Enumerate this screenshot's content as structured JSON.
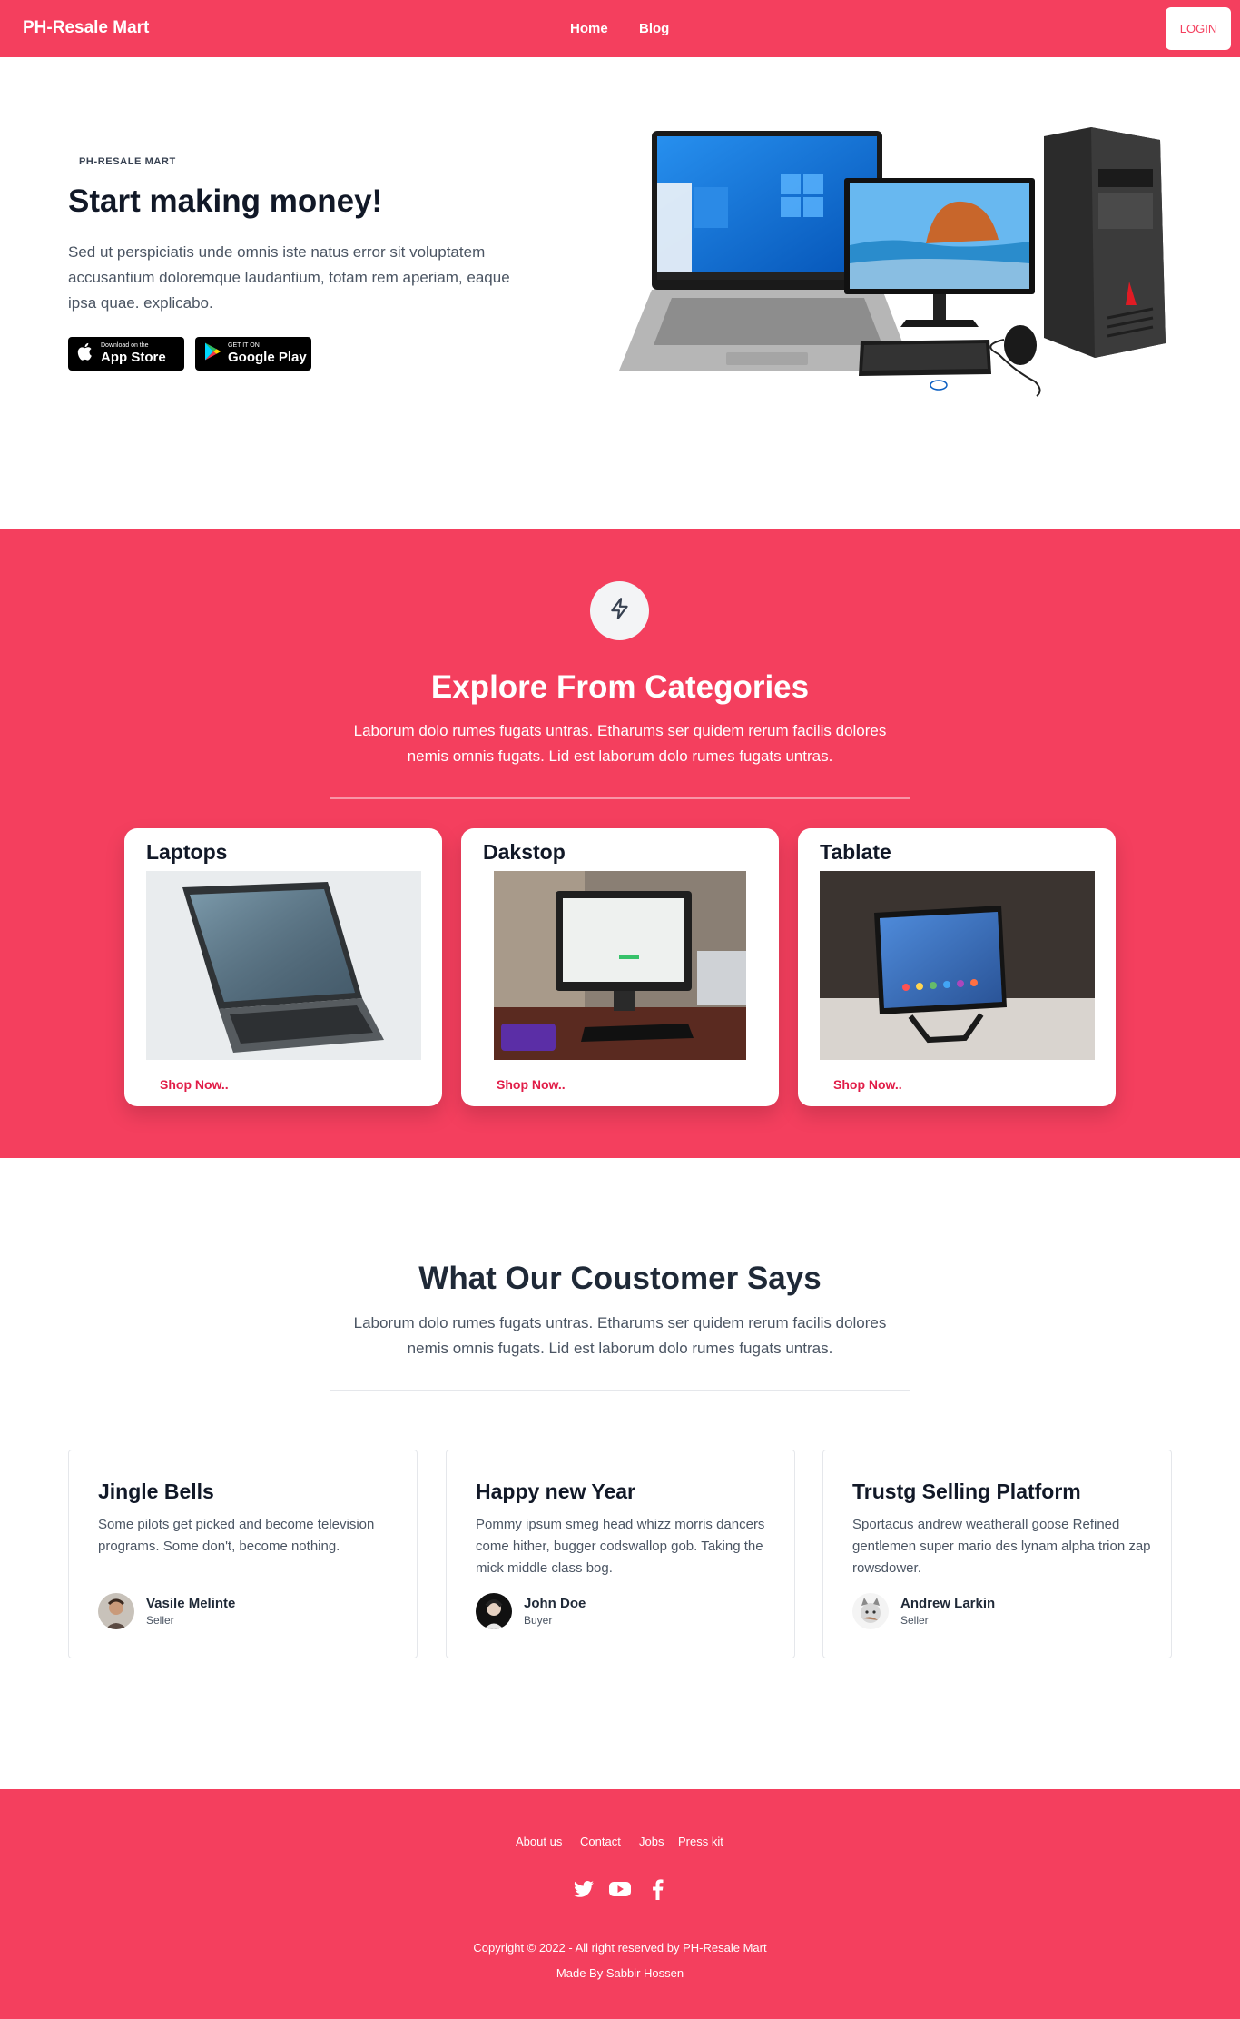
{
  "navbar": {
    "brand": "PH-Resale Mart",
    "links": [
      "Home",
      "Blog"
    ],
    "login_label": "LOGIN"
  },
  "hero": {
    "eyebrow": "PH-RESALE MART",
    "title": "Start making money!",
    "description": "Sed ut perspiciatis unde omnis iste natus error sit voluptatem accusantium doloremque laudantium, totam rem aperiam, eaque ipsa quae. explicabo.",
    "app_store": {
      "small": "Download on the",
      "big": "App Store"
    },
    "google_play": {
      "small": "GET IT ON",
      "big": "Google Play"
    }
  },
  "categories": {
    "icon": "lightning-bolt-icon",
    "title": "Explore From Categories",
    "description": "Laborum dolo rumes fugats untras. Etharums ser quidem rerum facilis dolores nemis omnis fugats. Lid est laborum dolo rumes fugats untras.",
    "items": [
      {
        "name": "Laptops",
        "cta": "Shop Now.."
      },
      {
        "name": "Dakstop",
        "cta": "Shop Now.."
      },
      {
        "name": "Tablate",
        "cta": "Shop Now.."
      }
    ]
  },
  "testimonials": {
    "title": "What Our Coustomer Says",
    "description": "Laborum dolo rumes fugats untras. Etharums ser quidem rerum facilis dolores nemis omnis fugats. Lid est laborum dolo rumes fugats untras.",
    "items": [
      {
        "title": "Jingle Bells",
        "body": "Some pilots get picked and become television programs. Some don't, become nothing.",
        "name": "Vasile Melinte",
        "role": "Seller"
      },
      {
        "title": "Happy new Year",
        "body": "Pommy ipsum smeg head whizz morris dancers come hither, bugger codswallop gob. Taking the mick middle class bog.",
        "name": "John Doe",
        "role": "Buyer"
      },
      {
        "title": "Trustg Selling Platform",
        "body": "Sportacus andrew weatherall goose Refined gentlemen super mario des lynam alpha trion zap rowsdower.",
        "name": "Andrew Larkin",
        "role": "Seller"
      }
    ]
  },
  "footer": {
    "links": [
      "About us",
      "Contact",
      "Jobs",
      "Press kit"
    ],
    "social_icons": [
      "twitter-icon",
      "youtube-icon",
      "facebook-icon"
    ],
    "copyright": "Copyright © 2022 - All right reserved by PH-Resale Mart",
    "made_by": "Made By Sabbir Hossen"
  },
  "colors": {
    "brand": "#f43f5e",
    "accent_text": "#e11d48",
    "dark_text": "#111827"
  }
}
